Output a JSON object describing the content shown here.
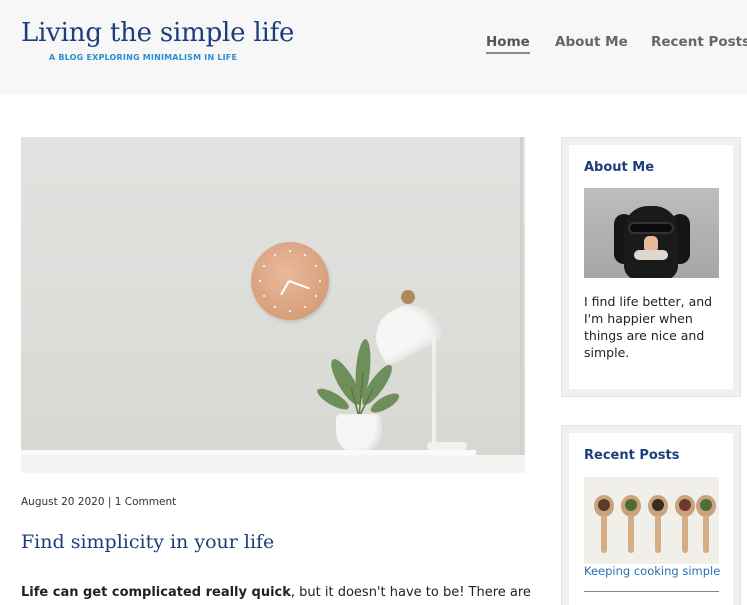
{
  "header": {
    "site_title": "Living the simple life",
    "tagline": "A BLOG EXPLORING MINIMALISM IN LIFE"
  },
  "nav": {
    "items": [
      {
        "label": "Home",
        "active": true
      },
      {
        "label": "About Me",
        "active": false
      },
      {
        "label": "Recent Posts",
        "active": false
      }
    ]
  },
  "post": {
    "date": "August 20 2020",
    "separator": "|",
    "comments": "1 Comment",
    "title": "Find simplicity in your life",
    "intro_bold": "Life can get complicated really quick",
    "intro_rest": ", but it doesn't have to be! There are"
  },
  "sidebar": {
    "about": {
      "title": "About Me",
      "text": "I find life better, and I'm happier when things are nice and simple."
    },
    "recent": {
      "title": "Recent Posts",
      "items": [
        {
          "label": "Keeping cooking simple"
        }
      ]
    }
  },
  "colors": {
    "brand": "#1c3f7a",
    "tagline": "#2a8fd0",
    "link": "#2a6fb5",
    "header_bg": "#f7f7f7",
    "widget_bg": "#f0f0ee"
  }
}
